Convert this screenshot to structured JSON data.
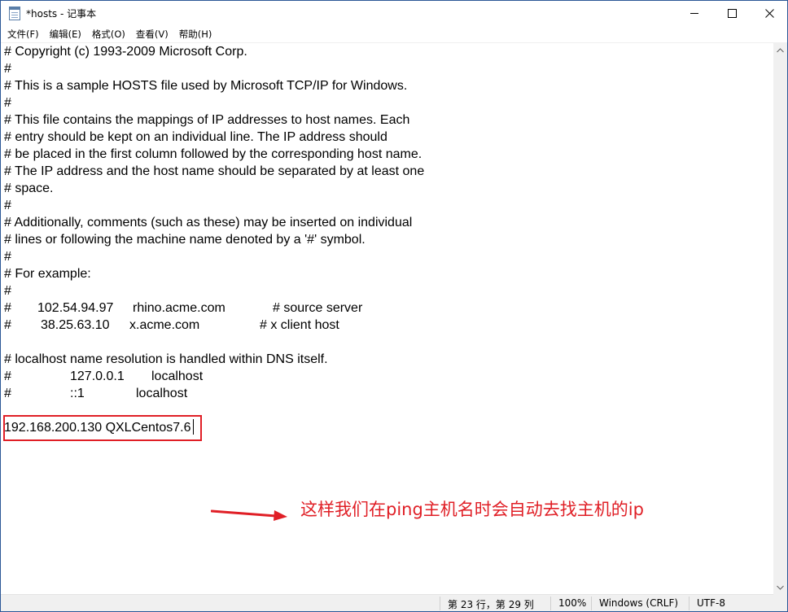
{
  "window": {
    "title": "*hosts - 记事本",
    "controls": {
      "minimize": "minimize-icon",
      "maximize": "maximize-icon",
      "close": "close-icon"
    }
  },
  "menu": [
    {
      "label": "文件(F)"
    },
    {
      "label": "编辑(E)"
    },
    {
      "label": "格式(O)"
    },
    {
      "label": "查看(V)"
    },
    {
      "label": "帮助(H)"
    }
  ],
  "editor": {
    "lines": [
      "# Copyright (c) 1993-2009 Microsoft Corp.",
      "#",
      "# This is a sample HOSTS file used by Microsoft TCP/IP for Windows.",
      "#",
      "# This file contains the mappings of IP addresses to host names. Each",
      "# entry should be kept on an individual line. The IP address should",
      "# be placed in the first column followed by the corresponding host name.",
      "# The IP address and the host name should be separated by at least one",
      "# space.",
      "#",
      "# Additionally, comments (such as these) may be inserted on individual",
      "# lines or following the machine name denoted by a '#' symbol.",
      "#",
      "# For example:",
      "#"
    ],
    "example_rows": [
      {
        "hash": "#",
        "ip": "102.54.94.97",
        "host": "rhino.acme.com",
        "comment": "# source server"
      },
      {
        "hash": "#",
        "ip": "38.25.63.10",
        "host": "x.acme.com",
        "comment": "# x client host"
      }
    ],
    "localhost_comment": "# localhost name resolution is handled within DNS itself.",
    "localhost_rows": [
      {
        "hash": "#",
        "ip": "127.0.0.1",
        "host": "localhost"
      },
      {
        "hash": "#",
        "ip": "::1",
        "host": "localhost"
      }
    ],
    "custom_entry": "192.168.200.130 QXLCentos7.6"
  },
  "annotation": {
    "text": "这样我们在ping主机名时会自动去找主机的ip",
    "color": "#e01f26"
  },
  "status_bar": {
    "position": "第 23 行，第 29 列",
    "zoom": "100%",
    "line_ending": "Windows (CRLF)",
    "encoding": "UTF-8"
  }
}
